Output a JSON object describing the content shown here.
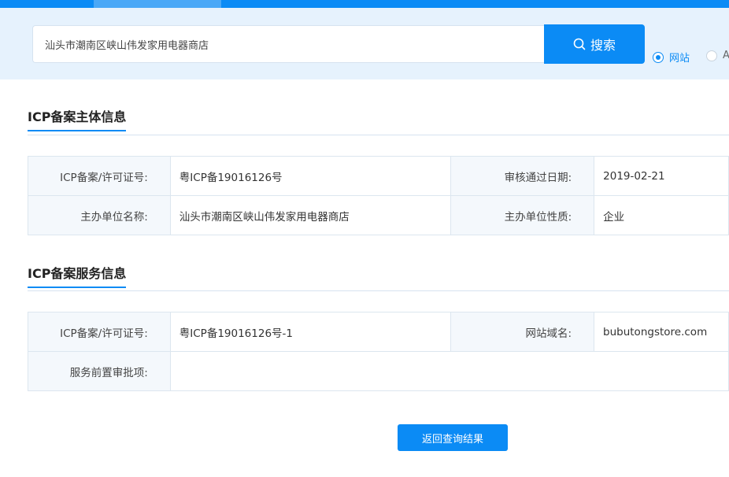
{
  "search": {
    "query": "汕头市潮南区峡山伟发家用电器商店",
    "button_label": "搜索",
    "options": [
      {
        "label": "网站",
        "checked": true
      },
      {
        "label": "APP",
        "checked": false
      }
    ]
  },
  "subject_section": {
    "title": "ICP备案主体信息",
    "rows": [
      {
        "label1": "ICP备案/许可证号:",
        "value1": "粤ICP备19016126号",
        "label2": "审核通过日期:",
        "value2": "2019-02-21"
      },
      {
        "label1": "主办单位名称:",
        "value1": "汕头市潮南区峡山伟发家用电器商店",
        "label2": "主办单位性质:",
        "value2": "企业"
      }
    ]
  },
  "service_section": {
    "title": "ICP备案服务信息",
    "rows": [
      {
        "label1": "ICP备案/许可证号:",
        "value1": "粤ICP备19016126号-1",
        "label2": "网站域名:",
        "value2": "bubutongstore.com"
      },
      {
        "label1": "服务前置审批项:",
        "value1": ""
      }
    ]
  },
  "back_button_label": "返回查询结果",
  "colors": {
    "accent": "#0b8bf5",
    "band": "#e6f2fd"
  }
}
